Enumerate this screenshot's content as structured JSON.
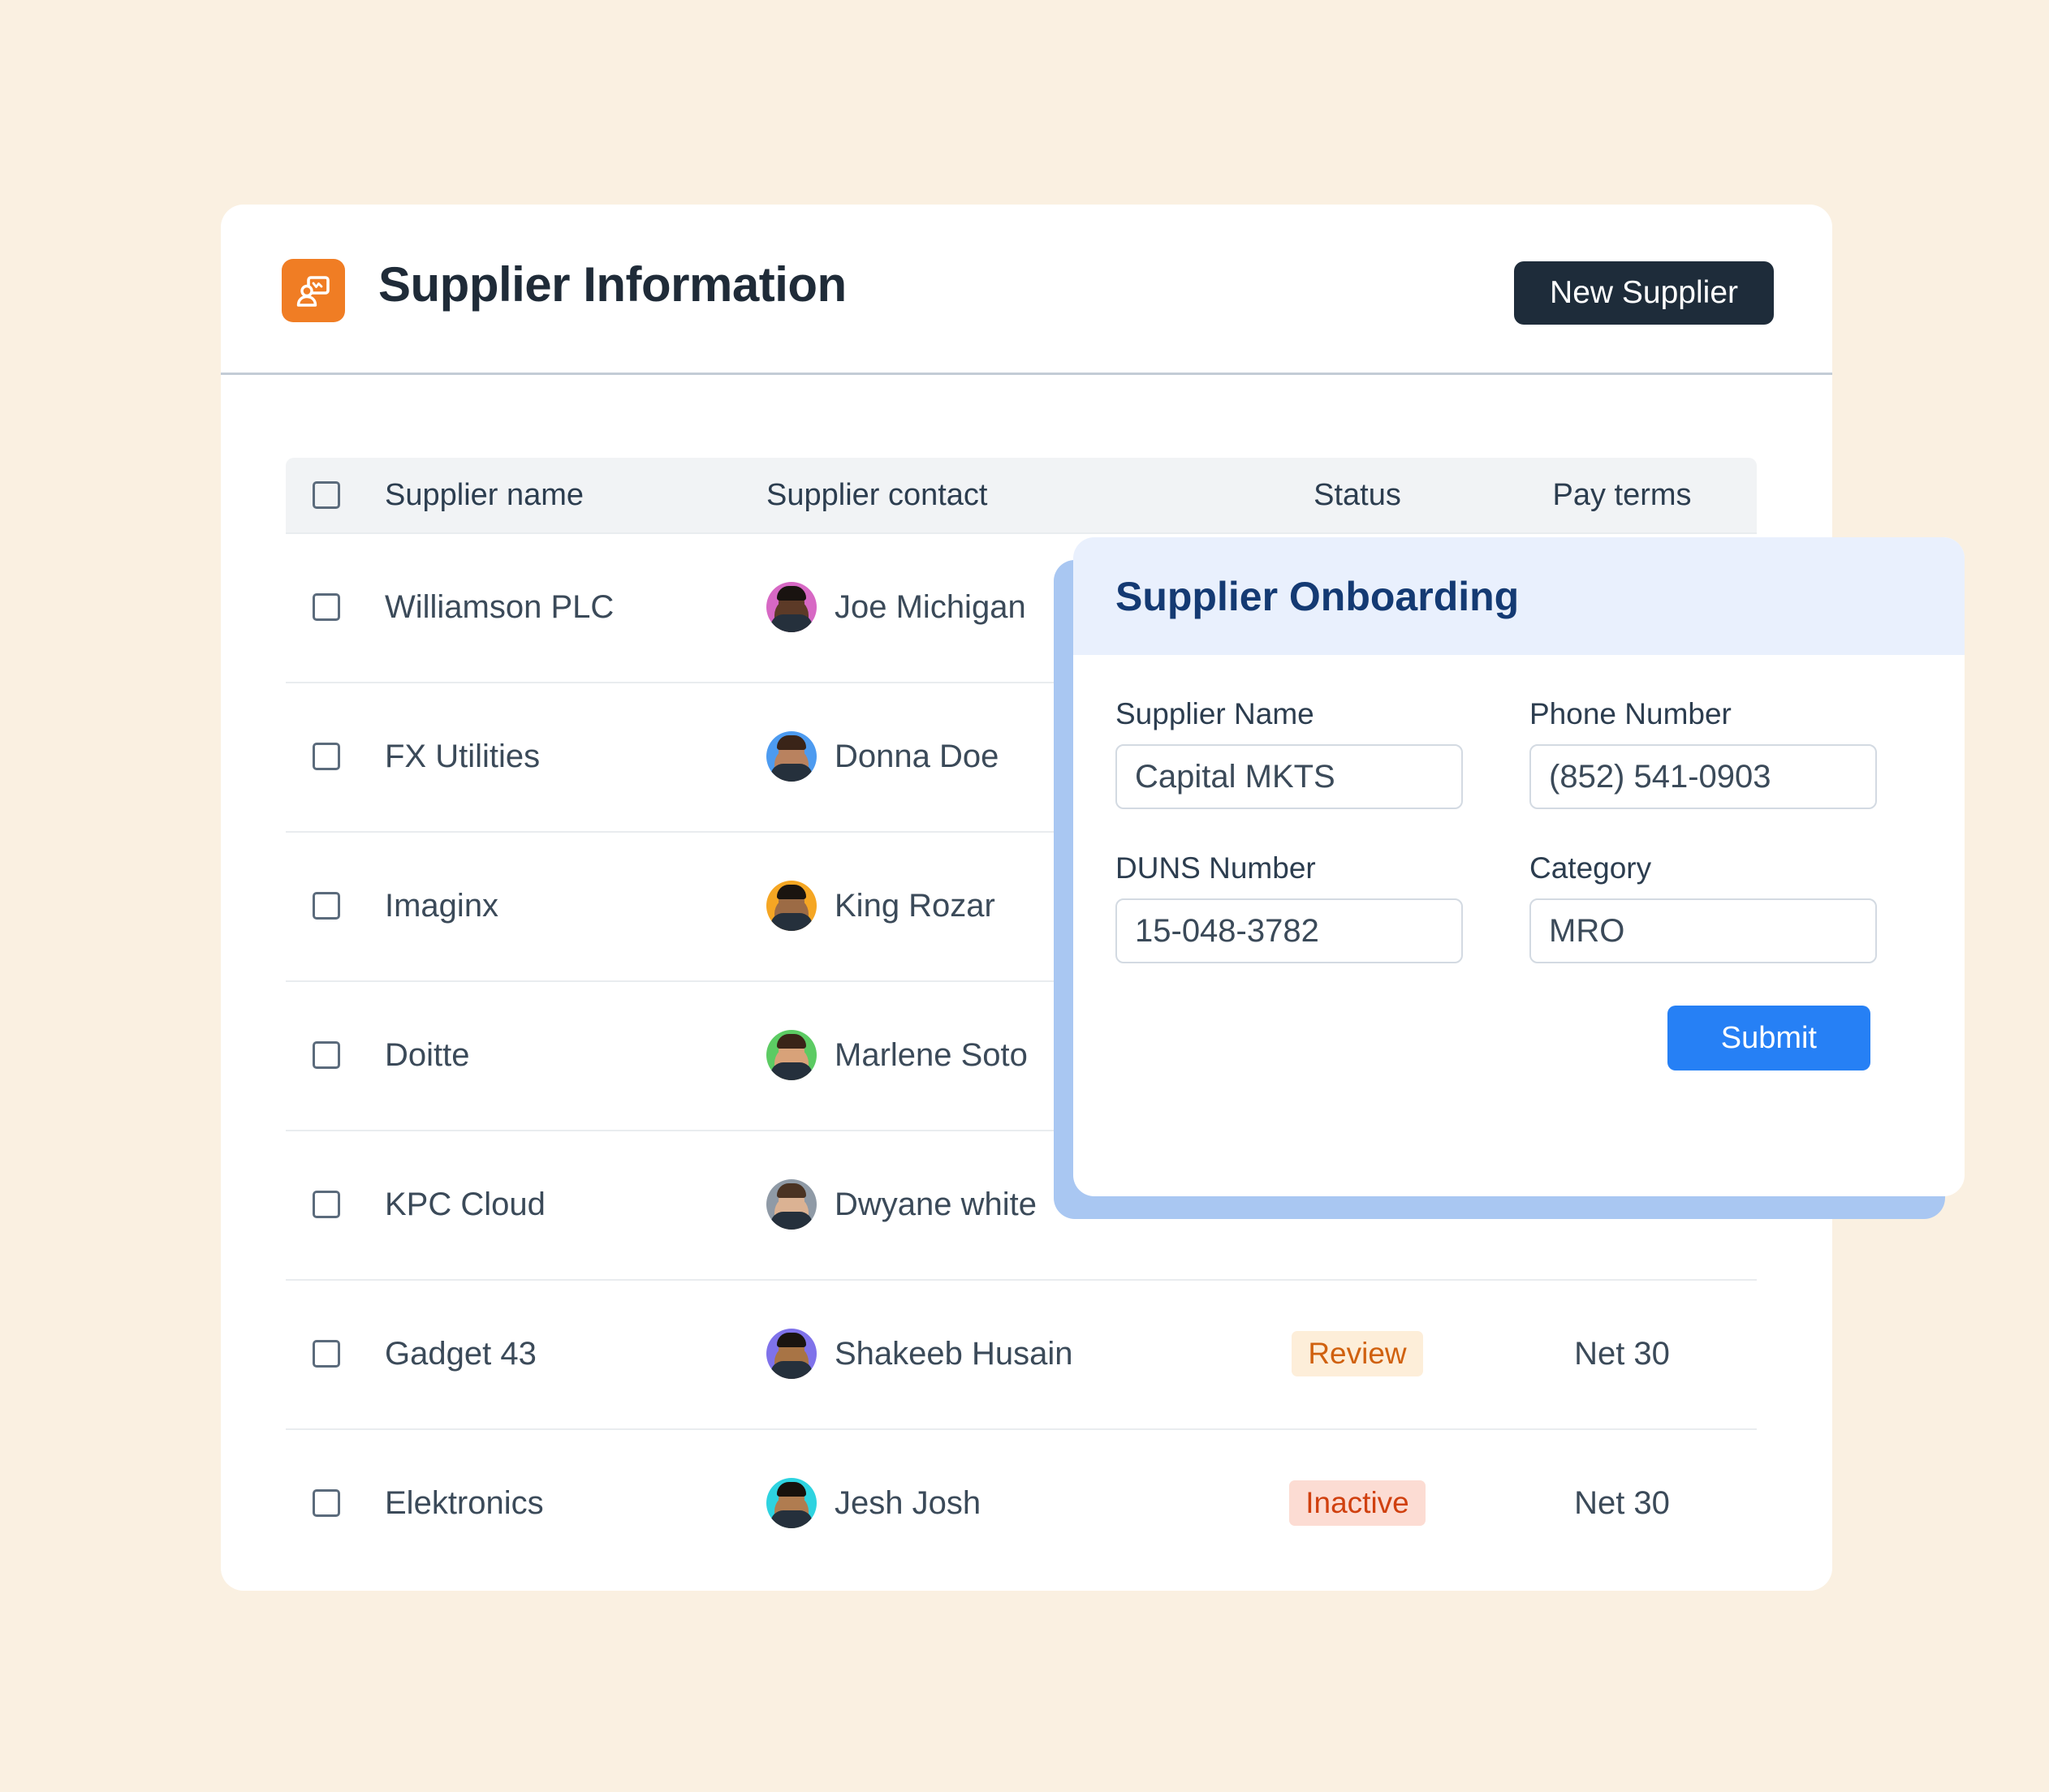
{
  "header": {
    "title": "Supplier Information",
    "icon": "supplier-presentation-icon",
    "new_supplier_label": "New Supplier"
  },
  "table": {
    "columns": [
      "Supplier name",
      "Supplier contact",
      "Status",
      "Pay terms"
    ],
    "rows": [
      {
        "name": "Williamson PLC",
        "contact": "Joe Michigan",
        "avatar_color": "#d768c4",
        "skin": "#5c3a27",
        "hair": "#191310",
        "status": "",
        "pay_terms": ""
      },
      {
        "name": "FX Utilities",
        "contact": "Donna Doe",
        "avatar_color": "#4d9bf0",
        "skin": "#b9825f",
        "hair": "#3a2418",
        "status": "",
        "pay_terms": ""
      },
      {
        "name": "Imaginx",
        "contact": "King Rozar",
        "avatar_color": "#f5a623",
        "skin": "#9c6b45",
        "hair": "#1a1410",
        "status": "",
        "pay_terms": ""
      },
      {
        "name": "Doitte",
        "contact": "Marlene Soto",
        "avatar_color": "#5ccb63",
        "skin": "#d8a279",
        "hair": "#3a2418",
        "status": "",
        "pay_terms": ""
      },
      {
        "name": "KPC Cloud",
        "contact": "Dwyane white",
        "avatar_color": "#8f9aa6",
        "skin": "#dbb293",
        "hair": "#4a3323",
        "status": "",
        "pay_terms": ""
      },
      {
        "name": "Gadget 43",
        "contact": "Shakeeb Husain",
        "avatar_color": "#7f72ea",
        "skin": "#a87445",
        "hair": "#1a1410",
        "status": "Review",
        "pay_terms": "Net 30"
      },
      {
        "name": "Elektronics",
        "contact": "Jesh Josh",
        "avatar_color": "#2ed3e0",
        "skin": "#b07c50",
        "hair": "#17110c",
        "status": "Inactive",
        "pay_terms": "Net 30"
      }
    ]
  },
  "modal": {
    "title": "Supplier Onboarding",
    "fields": [
      {
        "label": "Supplier Name",
        "value": "Capital MKTS"
      },
      {
        "label": "Phone Number",
        "value": "(852) 541-0903"
      },
      {
        "label": "DUNS Number",
        "value": "15-048-3782"
      },
      {
        "label": "Category",
        "value": "MRO"
      }
    ],
    "submit_label": "Submit"
  },
  "colors": {
    "page_background": "#faf0e1",
    "card_background": "#ffffff",
    "brand_orange": "#f07d24",
    "header_button": "#1e2c3a",
    "modal_header": "#e9f0fd",
    "modal_title": "#143a73",
    "modal_shadow": "#a9c7f2",
    "submit_blue": "#2680f5",
    "badge_review_bg": "#fdeed9",
    "badge_review_fg": "#d0610f",
    "badge_inactive_bg": "#fcdcd3",
    "badge_inactive_fg": "#d0400f",
    "table_header_bg": "#f1f3f5",
    "row_divider": "#e9ecef",
    "text_primary": "#3b4a59"
  }
}
